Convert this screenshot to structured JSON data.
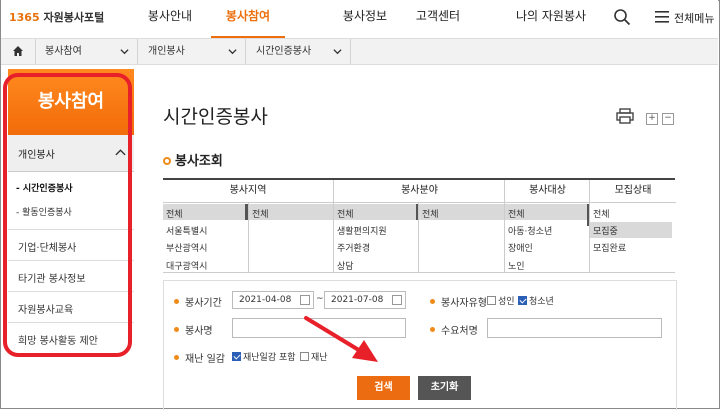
{
  "header": {
    "logo_number": "1365",
    "logo_text": "자원봉사포털",
    "nav": [
      "봉사안내",
      "봉사참여",
      "봉사정보",
      "고객센터",
      "나의 자원봉사"
    ],
    "active_nav": "봉사참여",
    "menu_label": "전체메뉴"
  },
  "breadcrumb": [
    "봉사참여",
    "개인봉사",
    "시간인증봉사"
  ],
  "sidebar": {
    "title": "봉사참여",
    "sub_title": "개인봉사",
    "links": [
      "- 시간인증봉사",
      "- 활동인증봉사"
    ],
    "items": [
      "기업·단체봉사",
      "타기관 봉사정보",
      "자원봉사교육",
      "희망 봉사활동 제안"
    ]
  },
  "main": {
    "title": "시간인증봉사",
    "section_title": "봉사조회",
    "zoom_in": "+",
    "zoom_out": "−"
  },
  "filters": {
    "headers": [
      "봉사지역",
      "봉사분야",
      "봉사대상",
      "모집상태"
    ],
    "region_a": [
      "전체",
      "서울특별시",
      "부산광역시",
      "대구광역시"
    ],
    "region_b": [
      "전체"
    ],
    "field_a": [
      "전체",
      "생활편의지원",
      "주거환경",
      "상담"
    ],
    "field_b": [
      "전체"
    ],
    "target": [
      "전체",
      "아동·청소년",
      "장애인",
      "노인"
    ],
    "status": [
      "전체",
      "모집중",
      "모집완료"
    ]
  },
  "form": {
    "period_label": "봉사기간",
    "date_from": "2021-04-08",
    "date_to": "2021-07-08",
    "tilde": "~",
    "type_label": "봉사자유형",
    "type_adult": "성인",
    "type_youth": "청소년",
    "name_label": "봉사명",
    "org_label": "수요처명",
    "disaster_label": "재난 일감",
    "disaster_include": "재난일감 포함",
    "disaster_only": "재난"
  },
  "buttons": {
    "search": "검색",
    "reset": "초기화"
  },
  "colors": {
    "accent": "#ee6f0d",
    "annotation": "#e8202a",
    "checkbox": "#2a5fb5"
  }
}
